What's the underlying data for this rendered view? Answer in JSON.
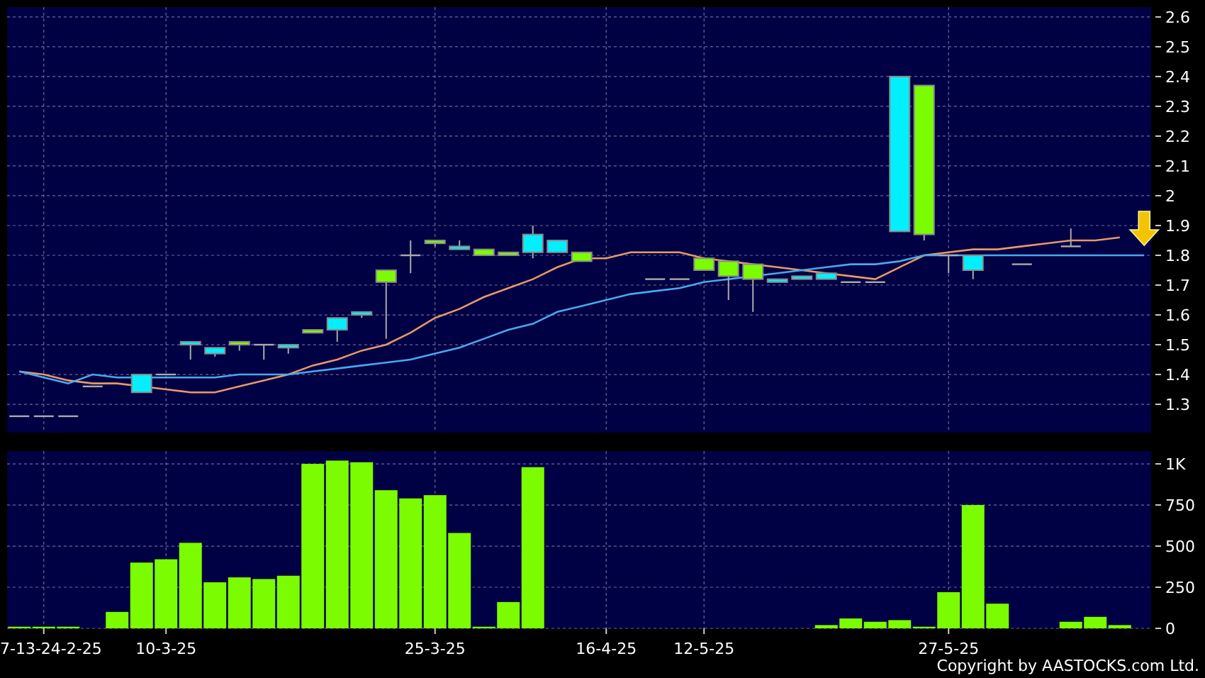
{
  "price_chart": {
    "chart_data": {
      "type": "candlestick",
      "ohlc": [
        [
          1.26,
          1.26,
          1.26,
          1.26
        ],
        [
          1.26,
          1.26,
          1.26,
          1.26
        ],
        [
          1.26,
          1.26,
          1.26,
          1.26
        ],
        [
          1.36,
          1.36,
          1.36,
          1.36
        ],
        null,
        [
          1.4,
          1.4,
          1.34,
          1.34
        ],
        [
          1.4,
          1.4,
          1.4,
          1.4
        ],
        [
          1.51,
          1.51,
          1.45,
          1.5
        ],
        [
          1.49,
          1.49,
          1.46,
          1.47
        ],
        [
          1.5,
          1.51,
          1.48,
          1.51
        ],
        [
          1.5,
          1.5,
          1.45,
          1.5
        ],
        [
          1.5,
          1.5,
          1.47,
          1.49
        ],
        [
          1.54,
          1.55,
          1.54,
          1.55
        ],
        [
          1.59,
          1.59,
          1.51,
          1.55
        ],
        [
          1.61,
          1.61,
          1.59,
          1.6
        ],
        [
          1.71,
          1.75,
          1.52,
          1.75
        ],
        [
          1.8,
          1.85,
          1.74,
          1.8
        ],
        [
          1.84,
          1.85,
          1.83,
          1.85
        ],
        [
          1.83,
          1.85,
          1.82,
          1.82
        ],
        [
          1.8,
          1.82,
          1.8,
          1.82
        ],
        [
          1.8,
          1.81,
          1.8,
          1.81
        ],
        [
          1.87,
          1.9,
          1.79,
          1.81
        ],
        [
          1.85,
          1.85,
          1.81,
          1.81
        ],
        [
          1.78,
          1.81,
          1.78,
          1.81
        ],
        null,
        null,
        [
          1.72,
          1.72,
          1.72,
          1.72
        ],
        [
          1.72,
          1.72,
          1.72,
          1.72
        ],
        [
          1.75,
          1.79,
          1.75,
          1.79
        ],
        [
          1.73,
          1.78,
          1.65,
          1.78
        ],
        [
          1.72,
          1.77,
          1.61,
          1.77
        ],
        [
          1.72,
          1.72,
          1.71,
          1.71
        ],
        [
          1.73,
          1.73,
          1.72,
          1.72
        ],
        [
          1.74,
          1.74,
          1.72,
          1.72
        ],
        [
          1.71,
          1.71,
          1.71,
          1.71
        ],
        [
          1.71,
          1.71,
          1.71,
          1.71
        ],
        [
          2.4,
          2.4,
          1.88,
          1.88
        ],
        [
          1.87,
          2.37,
          1.85,
          2.37
        ],
        [
          1.8,
          1.8,
          1.74,
          1.8
        ],
        [
          1.8,
          1.8,
          1.72,
          1.75
        ],
        null,
        [
          1.77,
          1.77,
          1.77,
          1.77
        ],
        null,
        [
          1.83,
          1.89,
          1.83,
          1.83
        ],
        null,
        null,
        null
      ],
      "ylim": [
        1.205,
        2.633
      ],
      "yticks": [
        1.3,
        1.4,
        1.5,
        1.6,
        1.7,
        1.8,
        1.9,
        2,
        2.1,
        2.2,
        2.3,
        2.4,
        2.5,
        2.6
      ],
      "grid": true,
      "series": [
        {
          "type": "line",
          "color": "#e89868",
          "values": [
            1.41,
            1.4,
            1.38,
            1.37,
            1.37,
            null,
            1.35,
            1.34,
            1.34,
            1.36,
            1.38,
            1.4,
            1.43,
            1.45,
            1.48,
            1.5,
            1.54,
            1.59,
            1.62,
            1.66,
            1.69,
            1.72,
            1.76,
            1.79,
            1.79,
            1.81,
            1.81,
            1.81,
            1.79,
            1.78,
            1.77,
            1.76,
            1.75,
            1.74,
            1.73,
            1.72,
            1.76,
            1.8,
            1.81,
            1.82,
            1.82,
            1.83,
            1.84,
            1.85,
            1.85,
            1.86,
            null
          ]
        },
        {
          "type": "line",
          "color": "#4aa8ec",
          "values": [
            1.41,
            1.39,
            1.37,
            1.4,
            1.39,
            1.39,
            1.39,
            1.39,
            1.39,
            1.4,
            1.4,
            1.4,
            1.41,
            1.42,
            1.43,
            1.44,
            1.45,
            1.47,
            1.49,
            1.52,
            1.55,
            1.57,
            1.61,
            1.63,
            1.65,
            1.67,
            1.68,
            1.69,
            1.71,
            1.72,
            null,
            1.74,
            1.75,
            1.76,
            1.77,
            1.77,
            1.78,
            1.8,
            1.8,
            1.8,
            1.8,
            1.8,
            1.8,
            1.8,
            1.8,
            1.8,
            1.8
          ]
        }
      ]
    }
  },
  "volume_chart": {
    "chart_data": {
      "type": "bar",
      "categories": [
        null,
        "7-13-24-2-25",
        null,
        null,
        null,
        null,
        "10-3-25",
        null,
        null,
        null,
        null,
        null,
        null,
        null,
        null,
        null,
        null,
        "25-3-25",
        null,
        null,
        null,
        null,
        null,
        null,
        "16-4-25",
        null,
        null,
        null,
        "12-5-25",
        null,
        null,
        null,
        null,
        null,
        null,
        null,
        null,
        null,
        "27-5-25",
        null,
        null,
        null,
        null,
        null,
        null,
        null,
        null
      ],
      "values": [
        10,
        10,
        10,
        0,
        100,
        400,
        420,
        520,
        280,
        310,
        300,
        320,
        1000,
        1020,
        1010,
        840,
        790,
        810,
        580,
        10,
        160,
        980,
        0,
        0,
        0,
        0,
        0,
        0,
        0,
        0,
        0,
        0,
        0,
        20,
        60,
        40,
        50,
        10,
        220,
        750,
        150,
        0,
        0,
        40,
        70,
        20,
        0
      ],
      "ylim": [
        0,
        1078
      ],
      "yticks": [
        0,
        250,
        500,
        750,
        {
          "value": 1000,
          "label": "1K"
        }
      ],
      "grid": true
    }
  },
  "copyright": "Copyright by AASTOCKS.com Ltd."
}
